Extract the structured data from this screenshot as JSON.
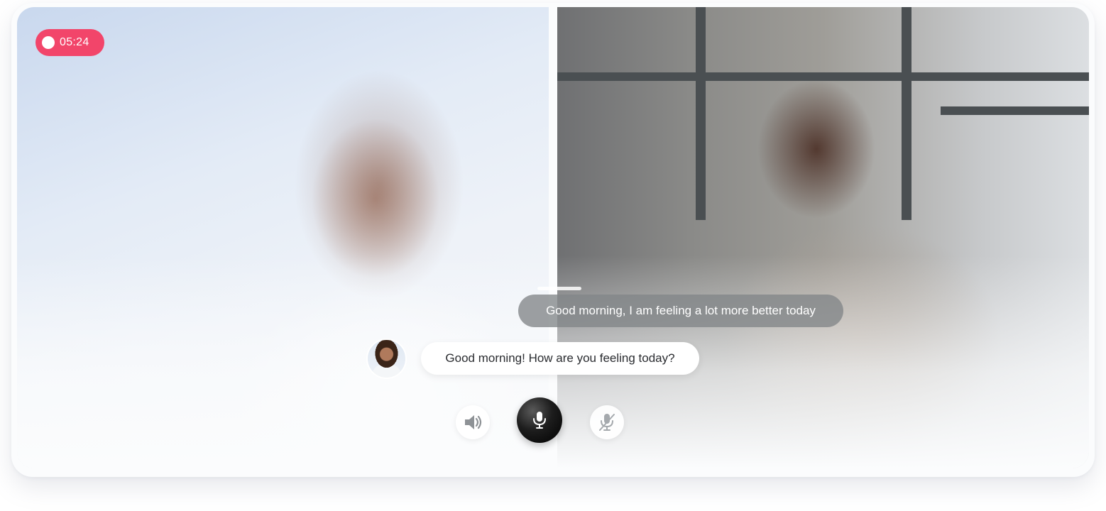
{
  "call": {
    "recording_time": "05:24",
    "doctor_message": "Good morning! How are you feeling today?",
    "patient_message": "Good morning, I am feeling a lot more better today"
  },
  "controls": [
    {
      "name": "speaker-icon"
    },
    {
      "name": "microphone-icon"
    },
    {
      "name": "microphone-muted-icon"
    }
  ],
  "colors": {
    "recording_badge": "#f2456a",
    "mic_button": "#000000",
    "patient_bubble": "#828588",
    "doctor_bubble": "#ffffff"
  }
}
